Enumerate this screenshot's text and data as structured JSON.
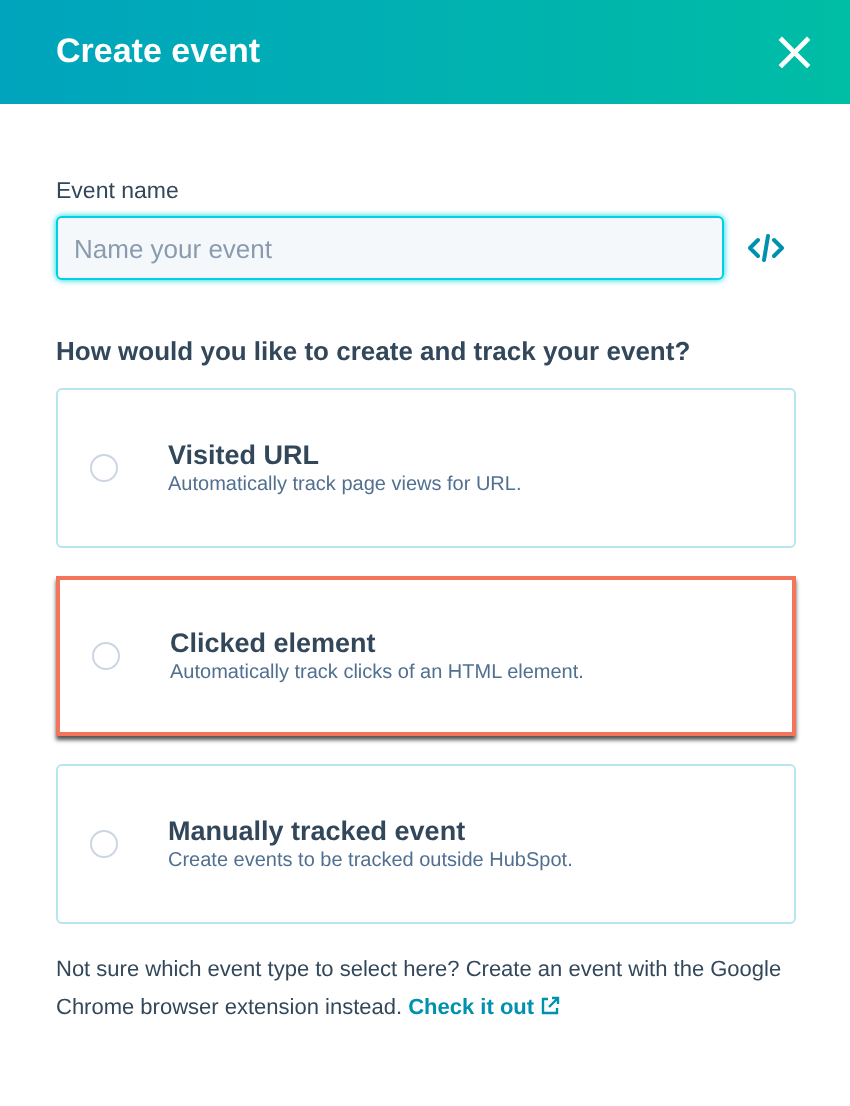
{
  "header": {
    "title": "Create event",
    "close_icon": "×"
  },
  "event_name": {
    "label": "Event name",
    "placeholder": "Name your event"
  },
  "question": "How would you like to create and track your event?",
  "options": [
    {
      "title": "Visited URL",
      "description": "Automatically track page views for URL.",
      "selected": false,
      "highlighted": false
    },
    {
      "title": "Clicked element",
      "description": "Automatically track clicks of an HTML element.",
      "selected": false,
      "highlighted": true
    },
    {
      "title": "Manually tracked event",
      "description": "Create events to be tracked outside HubSpot.",
      "selected": false,
      "highlighted": false
    }
  ],
  "footer": {
    "text": "Not sure which event type to select here? Create an event with the Google Chrome browser extension instead.",
    "link": "Check it out"
  }
}
